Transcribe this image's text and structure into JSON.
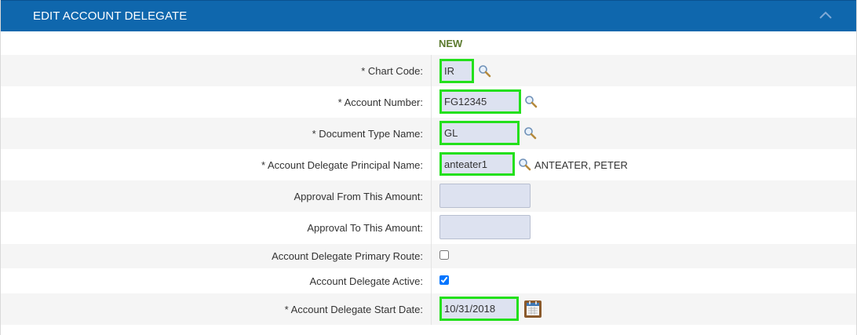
{
  "section": {
    "title": "EDIT ACCOUNT DELEGATE",
    "column_heading": "NEW"
  },
  "fields": {
    "chart_code": {
      "label": "* Chart Code:",
      "value": "IR"
    },
    "account_number": {
      "label": "* Account Number:",
      "value": "FG12345"
    },
    "document_type_name": {
      "label": "* Document Type Name:",
      "value": "GL"
    },
    "principal_name": {
      "label": "* Account Delegate Principal Name:",
      "value": "anteater1",
      "resolved_name": "ANTEATER, PETER"
    },
    "approval_from": {
      "label": "Approval From This Amount:",
      "value": ""
    },
    "approval_to": {
      "label": "Approval To This Amount:",
      "value": ""
    },
    "primary_route": {
      "label": "Account Delegate Primary Route:",
      "checked": false
    },
    "active": {
      "label": "Account Delegate Active:",
      "checked": true
    },
    "start_date": {
      "label": "* Account Delegate Start Date:",
      "value": "10/31/2018"
    }
  },
  "colors": {
    "header_bg": "#0f67ad",
    "highlight_border": "#23e01b",
    "input_bg": "#dde2f0",
    "new_label": "#5b7a2e"
  },
  "icons": {
    "collapse": "chevron-up-icon",
    "lookup": "magnifier-icon",
    "calendar": "calendar-icon"
  }
}
